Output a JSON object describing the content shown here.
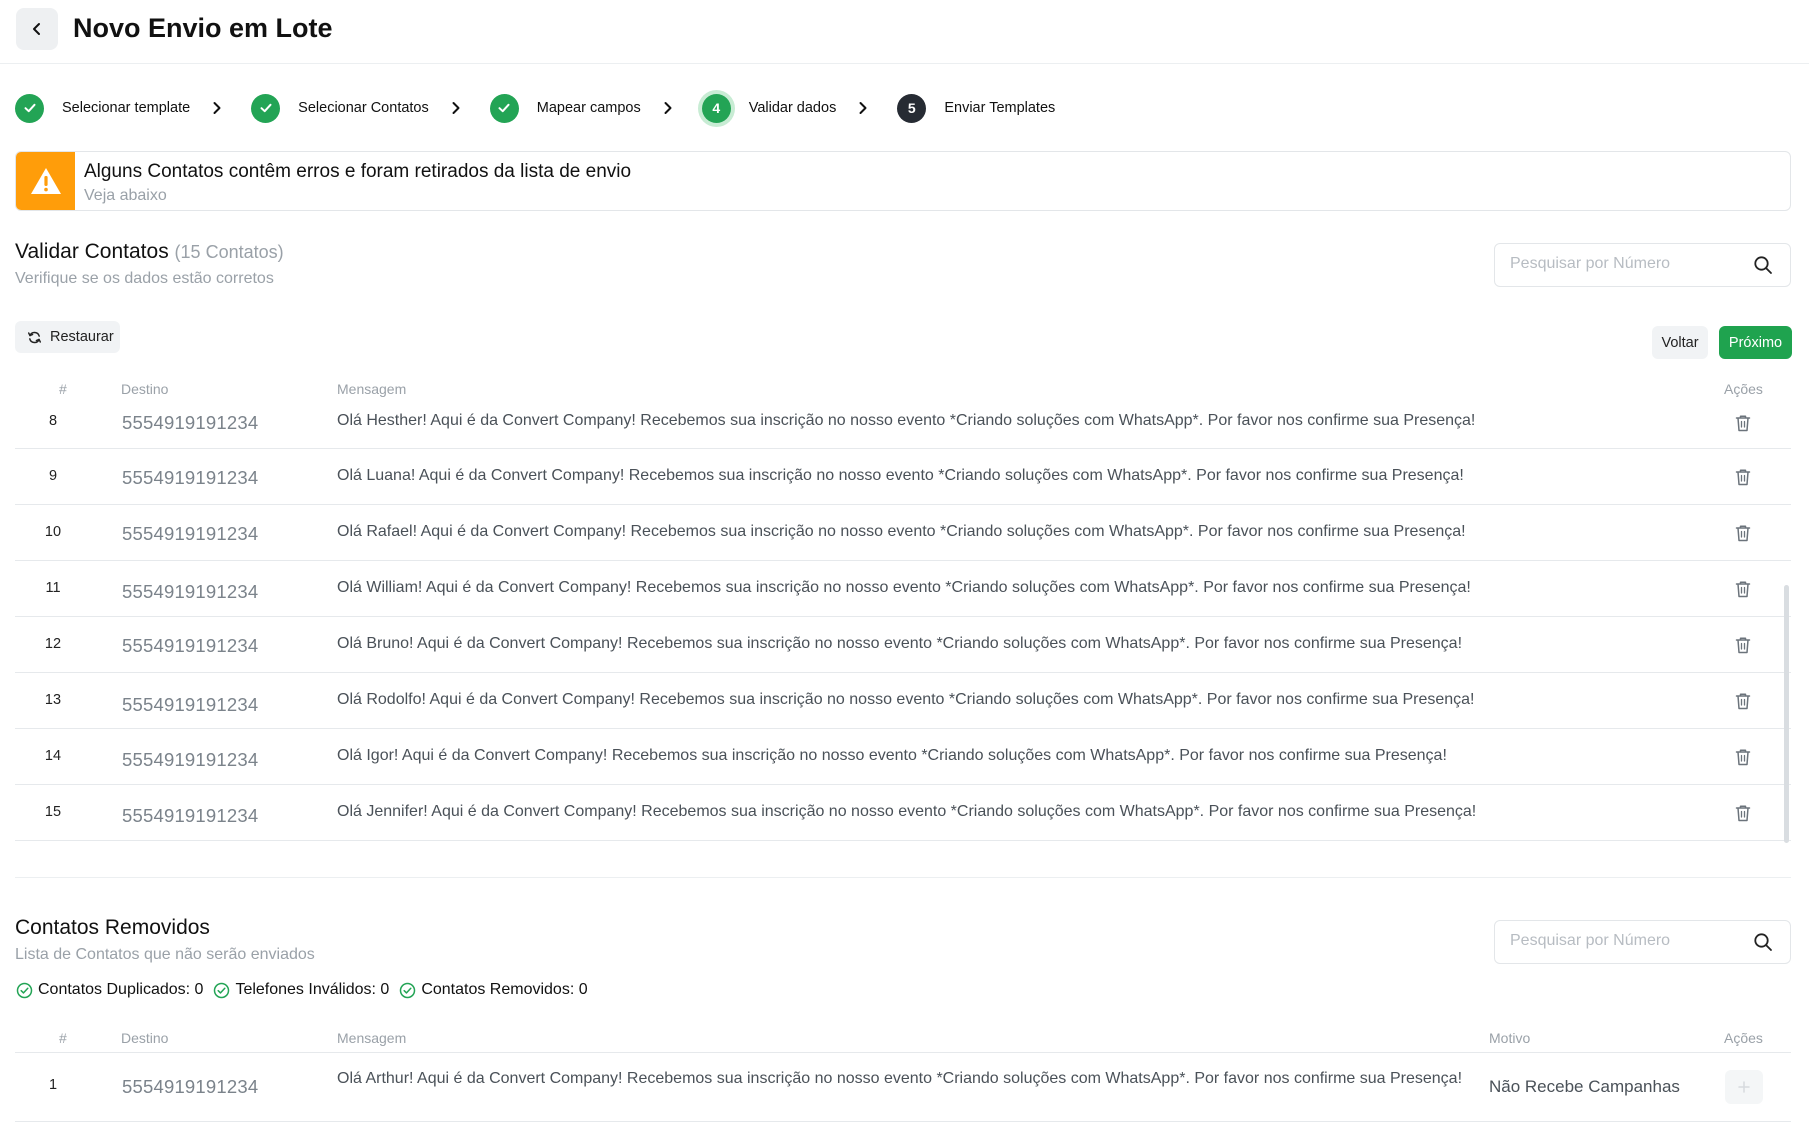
{
  "header": {
    "title": "Novo Envio em Lote"
  },
  "stepper": {
    "steps": [
      {
        "label": "Selecionar template",
        "status": "done"
      },
      {
        "label": "Selecionar Contatos",
        "status": "done"
      },
      {
        "label": "Mapear campos",
        "status": "done"
      },
      {
        "label": "Validar dados",
        "status": "active",
        "number": "4"
      },
      {
        "label": "Enviar Templates",
        "status": "todo",
        "number": "5"
      }
    ]
  },
  "alert": {
    "title": "Alguns Contatos contêm erros e foram retirados da lista de envio",
    "subtitle": "Veja abaixo"
  },
  "validate": {
    "title": "Validar Contatos",
    "count": "(15 Contatos)",
    "subtitle": "Verifique se os dados estão corretos",
    "search_placeholder": "Pesquisar por Número",
    "restore_label": "Restaurar",
    "back_label": "Voltar",
    "next_label": "Próximo",
    "columns": {
      "num": "#",
      "dest": "Destino",
      "msg": "Mensagem",
      "actions": "Ações"
    },
    "rows": [
      {
        "num": "8",
        "dest": "5554919191234",
        "msg": "Olá Hesther! Aqui é da Convert Company! Recebemos sua inscrição no nosso evento *Criando soluções com WhatsApp*. Por favor nos confirme sua Presença!"
      },
      {
        "num": "9",
        "dest": "5554919191234",
        "msg": "Olá Luana! Aqui é da Convert Company! Recebemos sua inscrição no nosso evento *Criando soluções com WhatsApp*. Por favor nos confirme sua Presença!"
      },
      {
        "num": "10",
        "dest": "5554919191234",
        "msg": "Olá Rafael! Aqui é da Convert Company! Recebemos sua inscrição no nosso evento *Criando soluções com WhatsApp*. Por favor nos confirme sua Presença!"
      },
      {
        "num": "11",
        "dest": "5554919191234",
        "msg": "Olá William! Aqui é da Convert Company! Recebemos sua inscrição no nosso evento *Criando soluções com WhatsApp*. Por favor nos confirme sua Presença!"
      },
      {
        "num": "12",
        "dest": "5554919191234",
        "msg": "Olá Bruno! Aqui é da Convert Company! Recebemos sua inscrição no nosso evento *Criando soluções com WhatsApp*. Por favor nos confirme sua Presença!"
      },
      {
        "num": "13",
        "dest": "5554919191234",
        "msg": "Olá Rodolfo! Aqui é da Convert Company! Recebemos sua inscrição no nosso evento *Criando soluções com WhatsApp*. Por favor nos confirme sua Presença!"
      },
      {
        "num": "14",
        "dest": "5554919191234",
        "msg": "Olá Igor! Aqui é da Convert Company! Recebemos sua inscrição no nosso evento *Criando soluções com WhatsApp*. Por favor nos confirme sua Presença!"
      },
      {
        "num": "15",
        "dest": "5554919191234",
        "msg": "Olá Jennifer! Aqui é da Convert Company! Recebemos sua inscrição no nosso evento *Criando soluções com WhatsApp*. Por favor nos confirme sua Presença!"
      }
    ]
  },
  "removed": {
    "title": "Contatos Removidos",
    "subtitle": "Lista de Contatos que não serão enviados",
    "search_placeholder": "Pesquisar por Número",
    "stats": {
      "duplicated": "Contatos Duplicados: 0",
      "invalid": "Telefones Inválidos: 0",
      "removed": "Contatos Removidos: 0"
    },
    "columns": {
      "num": "#",
      "dest": "Destino",
      "msg": "Mensagem",
      "motivo": "Motivo",
      "actions": "Ações"
    },
    "rows": [
      {
        "num": "1",
        "dest": "5554919191234",
        "msg": "Olá Arthur! Aqui é da Convert Company! Recebemos sua inscrição no nosso evento *Criando soluções com WhatsApp*. Por favor nos confirme sua Presença!",
        "motivo": "Não Recebe Campanhas"
      }
    ]
  },
  "colors": {
    "success": "#23a455",
    "warning": "#ff9d0a",
    "dark": "#262b33",
    "primary_button": "#1fa34f"
  }
}
